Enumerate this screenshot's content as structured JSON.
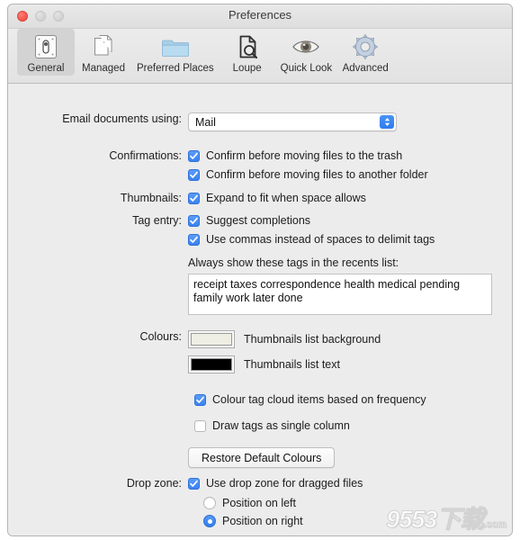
{
  "window": {
    "title": "Preferences",
    "traffic_lights": [
      "close",
      "minimize",
      "zoom"
    ]
  },
  "toolbar": {
    "items": [
      {
        "label": "General",
        "icon": "general-switch-icon",
        "selected": true
      },
      {
        "label": "Managed",
        "icon": "documents-copy-icon",
        "selected": false
      },
      {
        "label": "Preferred Places",
        "icon": "folder-icon",
        "selected": false
      },
      {
        "label": "Loupe",
        "icon": "document-magnifier-icon",
        "selected": false
      },
      {
        "label": "Quick Look",
        "icon": "eye-icon",
        "selected": false
      },
      {
        "label": "Advanced",
        "icon": "gear-icon",
        "selected": false
      }
    ]
  },
  "form": {
    "email": {
      "label": "Email documents using:",
      "value": "Mail",
      "options": [
        "Mail"
      ]
    },
    "confirmations": {
      "label": "Confirmations:",
      "items": [
        {
          "text": "Confirm before moving files to the trash",
          "checked": true
        },
        {
          "text": "Confirm before moving files to another folder",
          "checked": true
        }
      ]
    },
    "thumbnails": {
      "label": "Thumbnails:",
      "items": [
        {
          "text": "Expand to fit when space allows",
          "checked": true
        }
      ]
    },
    "tag_entry": {
      "label": "Tag entry:",
      "items": [
        {
          "text": "Suggest completions",
          "checked": true
        },
        {
          "text": "Use commas instead of spaces to delimit tags",
          "checked": true
        }
      ]
    },
    "recents": {
      "note": "Always show these tags in the recents list:",
      "tags_value": "receipt taxes correspondence health medical pending family work later done"
    },
    "colours": {
      "label": "Colours:",
      "wells": [
        {
          "label": "Thumbnails list background",
          "color": "#eeeee4"
        },
        {
          "label": "Thumbnails list text",
          "color": "#000000"
        }
      ],
      "items": [
        {
          "text": "Colour tag cloud items based on frequency",
          "checked": true
        },
        {
          "text": "Draw tags as single column",
          "checked": false
        }
      ],
      "restore_button": "Restore Default Colours"
    },
    "drop_zone": {
      "label": "Drop zone:",
      "checkbox": {
        "text": "Use drop zone for dragged files",
        "checked": true
      },
      "radios": [
        {
          "text": "Position on left",
          "selected": false
        },
        {
          "text": "Position on right",
          "selected": true
        }
      ]
    }
  },
  "watermark": {
    "text": "9553下载",
    "suffix": ".com"
  },
  "colors": {
    "accent": "#3b82f1",
    "window_bg": "#ececec",
    "toolbar_selected": "#d3d3d3"
  }
}
